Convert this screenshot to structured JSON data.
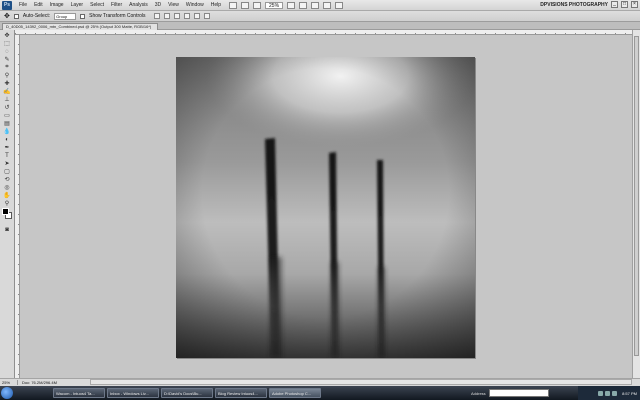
{
  "menubar": {
    "logo": "Ps",
    "items": [
      "File",
      "Edit",
      "Image",
      "Layer",
      "Select",
      "Filter",
      "Analysis",
      "3D",
      "View",
      "Window",
      "Help"
    ],
    "zoom": "25%",
    "workspace": "DPVISIONS PHOTOGRAPHY"
  },
  "options": {
    "auto_select_label": "Auto-Select:",
    "auto_select_value": "Group",
    "transform_label": "Show Transform Controls"
  },
  "document": {
    "tab_title": "D_40D05_14392_0006_mtn_Combined.psd @ 25% (Output 300 Matte, RGB/16*)"
  },
  "status": {
    "zoom": "25%",
    "doc_info": "Doc: 76.2M/296.4M"
  },
  "taskbar": {
    "buttons": [
      "Wacom - Intuos4 Ta...",
      "Inbox - Windows Liv...",
      "D:\\David's Docs\\Bu...",
      "Blog Review Intuos4...",
      "Adobe Photoshop C..."
    ],
    "active_index": 4,
    "address_label": "Address",
    "clock": "8:57 PM"
  },
  "colors": {
    "menu_bg": "#d9d9d9",
    "canvas_bg": "#c6c6c6",
    "taskbar_bg": "#1f2733"
  }
}
